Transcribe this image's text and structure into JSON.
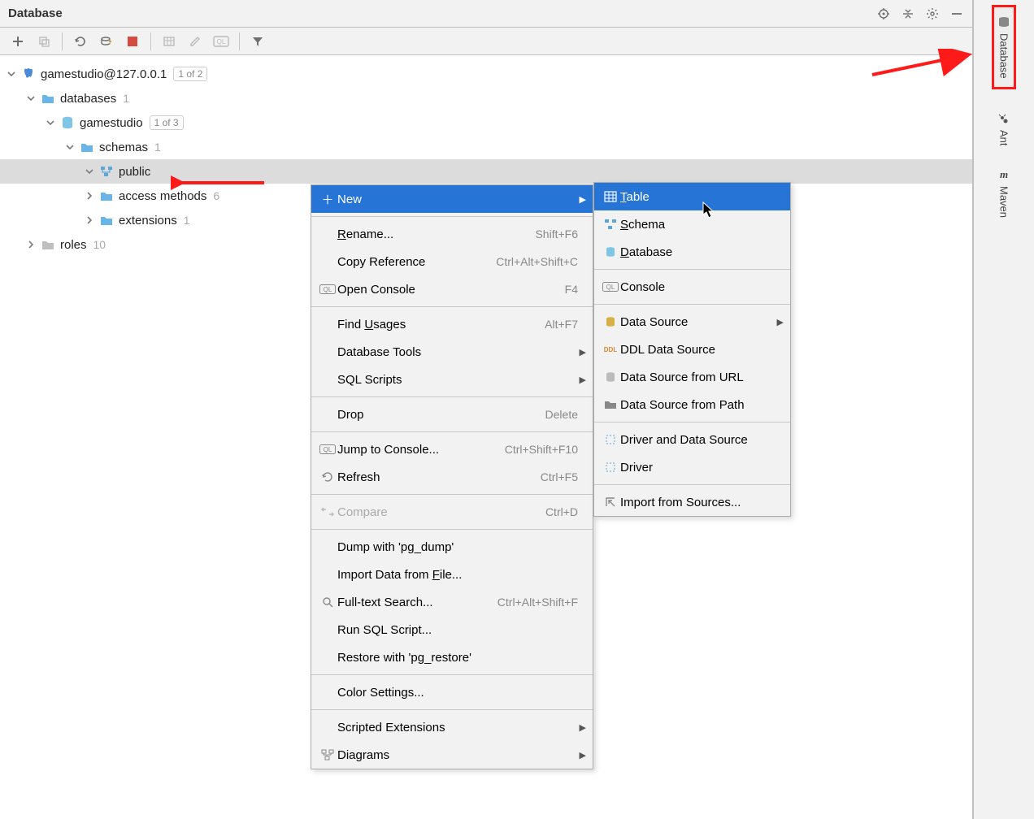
{
  "panel": {
    "title": "Database"
  },
  "tree": {
    "ds": {
      "label": "gamestudio@127.0.0.1",
      "badge": "1 of 2"
    },
    "databases": {
      "label": "databases",
      "count": "1"
    },
    "db": {
      "label": "gamestudio",
      "badge": "1 of 3"
    },
    "schemas": {
      "label": "schemas",
      "count": "1"
    },
    "public": {
      "label": "public"
    },
    "access": {
      "label": "access methods",
      "count": "6"
    },
    "extensions": {
      "label": "extensions",
      "count": "1"
    },
    "roles": {
      "label": "roles",
      "count": "10"
    }
  },
  "menu": {
    "new": "New",
    "rename": {
      "t": "ename...",
      "u": "R",
      "s": "Shift+F6"
    },
    "copyref": {
      "t": "Copy Reference",
      "s": "Ctrl+Alt+Shift+C"
    },
    "console": {
      "t": "Open Console",
      "s": "F4"
    },
    "findusages": {
      "pre": "Find ",
      "u": "U",
      "post": "sages",
      "s": "Alt+F7"
    },
    "dbtools": "Database Tools",
    "sqlscripts": "SQL Scripts",
    "drop": {
      "t": "Drop",
      "s": "Delete"
    },
    "jump": {
      "t": "Jump to Console...",
      "s": "Ctrl+Shift+F10"
    },
    "refresh": {
      "t": "Refresh",
      "s": "Ctrl+F5"
    },
    "compare": {
      "t": "Compare",
      "s": "Ctrl+D"
    },
    "dump": "Dump with 'pg_dump'",
    "import": {
      "pre": "Import Data from ",
      "u": "F",
      "post": "ile..."
    },
    "fts": {
      "t": "Full-text Search...",
      "s": "Ctrl+Alt+Shift+F"
    },
    "runsql": "Run SQL Script...",
    "restore": "Restore with 'pg_restore'",
    "color": "Color Settings...",
    "scriptext": "Scripted Extensions",
    "diagrams": "Diagrams"
  },
  "submenu": {
    "table": {
      "u": "T",
      "post": "able"
    },
    "schema": {
      "u": "S",
      "post": "chema"
    },
    "database": {
      "u": "D",
      "post": "atabase"
    },
    "console": "Console",
    "datasource": "Data Source",
    "ddl": "DDL Data Source",
    "url": "Data Source from URL",
    "path": "Data Source from Path",
    "driverds": "Driver and Data Source",
    "driver": "Driver",
    "import": "Import from Sources..."
  },
  "sidebar": {
    "database": "Database",
    "ant": "Ant",
    "maven": "Maven"
  }
}
